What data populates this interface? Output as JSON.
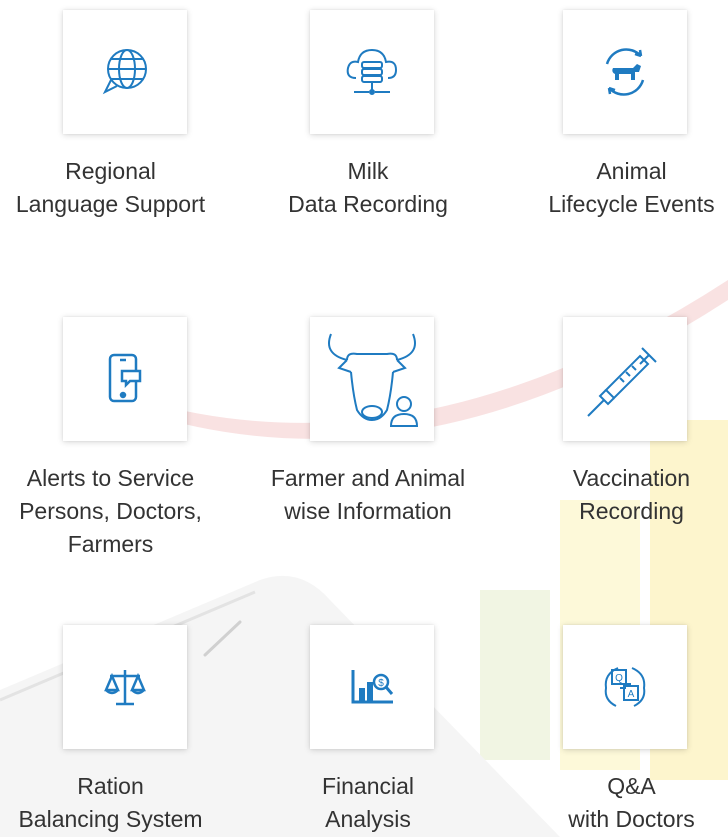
{
  "colors": {
    "icon_blue": "#1f7bc1",
    "text": "#333333",
    "tile_bg": "#ffffff"
  },
  "features": [
    {
      "icon": "globe-chat-icon",
      "lines": [
        "Regional",
        "Language Support"
      ]
    },
    {
      "icon": "cloud-database-icon",
      "lines": [
        "Milk",
        "Data Recording"
      ]
    },
    {
      "icon": "cow-cycle-icon",
      "lines": [
        "Animal",
        "Lifecycle Events"
      ]
    },
    {
      "icon": "mobile-alert-icon",
      "lines": [
        "Alerts to Service",
        "Persons, Doctors,",
        "Farmers"
      ]
    },
    {
      "icon": "bull-person-icon",
      "lines": [
        "Farmer and Animal",
        "wise Information"
      ]
    },
    {
      "icon": "syringe-icon",
      "lines": [
        "Vaccination",
        "Recording"
      ]
    },
    {
      "icon": "balance-scale-icon",
      "lines": [
        "Ration",
        "Balancing System"
      ]
    },
    {
      "icon": "bar-chart-dollar-icon",
      "lines": [
        "Financial",
        "Analysis"
      ]
    },
    {
      "icon": "question-answer-icon",
      "lines": [
        "Q&A",
        "with Doctors"
      ]
    }
  ]
}
